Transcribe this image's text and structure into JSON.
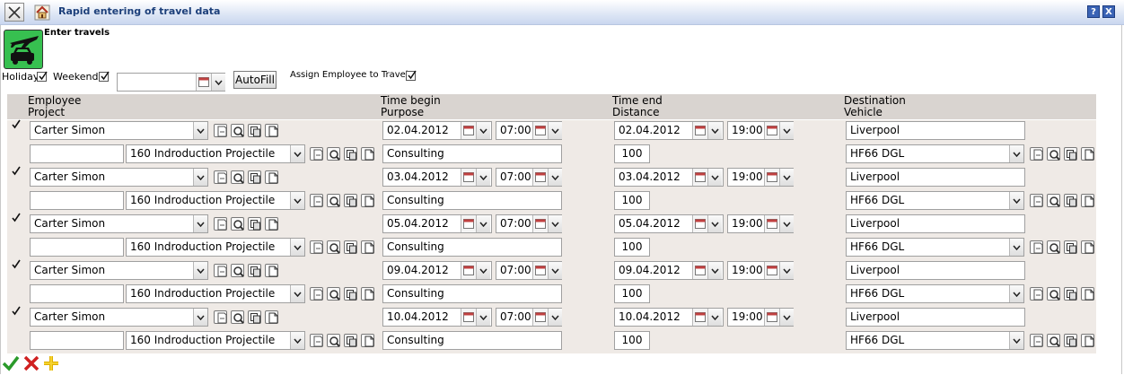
{
  "window": {
    "title": "Rapid entering of travel data",
    "help_label": "?",
    "close_label": "X"
  },
  "toolbar": {
    "enter_travels": "Enter travels",
    "holiday_label": "Holiday",
    "weekend_label": "Weekend",
    "autofill_label": "AutoFill",
    "assign_label": "Assign Employee to Travel",
    "date_value": ""
  },
  "headers": {
    "col1_line1": "Employee",
    "col1_line2": "Project",
    "col2_line1": "Time begin",
    "col2_line2": "Purpose",
    "col3_line1": "Time end",
    "col3_line2": "Distance",
    "col4_line1": "Destination",
    "col4_line2": "Vehicle"
  },
  "rows": [
    {
      "employee": "Carter Simon",
      "project": "160 Indroduction Projectile",
      "begin_date": "02.04.2012",
      "begin_time": "07:00",
      "purpose": "Consulting",
      "end_date": "02.04.2012",
      "end_time": "19:00",
      "distance": "100",
      "destination": "Liverpool",
      "vehicle": "HF66 DGL"
    },
    {
      "employee": "Carter Simon",
      "project": "160 Indroduction Projectile",
      "begin_date": "03.04.2012",
      "begin_time": "07:00",
      "purpose": "Consulting",
      "end_date": "03.04.2012",
      "end_time": "19:00",
      "distance": "100",
      "destination": "Liverpool",
      "vehicle": "HF66 DGL"
    },
    {
      "employee": "Carter Simon",
      "project": "160 Indroduction Projectile",
      "begin_date": "05.04.2012",
      "begin_time": "07:00",
      "purpose": "Consulting",
      "end_date": "05.04.2012",
      "end_time": "19:00",
      "distance": "100",
      "destination": "Liverpool",
      "vehicle": "HF66 DGL"
    },
    {
      "employee": "Carter Simon",
      "project": "160 Indroduction Projectile",
      "begin_date": "09.04.2012",
      "begin_time": "07:00",
      "purpose": "Consulting",
      "end_date": "09.04.2012",
      "end_time": "19:00",
      "distance": "100",
      "destination": "Liverpool",
      "vehicle": "HF66 DGL"
    },
    {
      "employee": "Carter Simon",
      "project": "160 Indroduction Projectile",
      "begin_date": "10.04.2012",
      "begin_time": "07:00",
      "purpose": "Consulting",
      "end_date": "10.04.2012",
      "end_time": "19:00",
      "distance": "100",
      "destination": "Liverpool",
      "vehicle": "HF66 DGL"
    }
  ],
  "icons": {
    "window_close": "close-icon",
    "home": "home-icon",
    "travel": "airplane-car-icon",
    "save": "check-icon",
    "cancel": "red-x-icon",
    "add": "plus-icon"
  },
  "colors": {
    "title_text": "#1c3f7a",
    "header_bg": "#d9d4d0",
    "row_bg": "#efeae6",
    "travel_icon_bg": "#37c050"
  }
}
